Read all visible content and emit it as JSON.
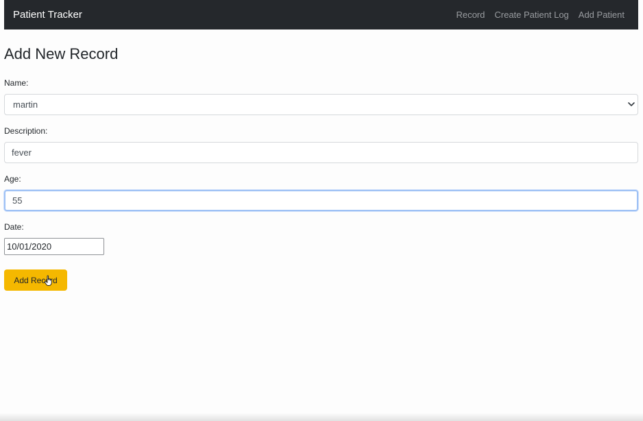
{
  "navbar": {
    "brand": "Patient Tracker",
    "links": [
      {
        "label": "Record"
      },
      {
        "label": "Create Patient Log"
      },
      {
        "label": "Add Patient"
      }
    ]
  },
  "page": {
    "title": "Add New Record"
  },
  "form": {
    "name": {
      "label": "Name:",
      "selected": "martin"
    },
    "description": {
      "label": "Description:",
      "value": "fever"
    },
    "age": {
      "label": "Age:",
      "value": "55"
    },
    "date": {
      "label": "Date:",
      "value": "10/01/2020"
    },
    "submit_label": "Add Record"
  },
  "icons": {
    "select_arrow": "chevron-down-icon",
    "cursor": "hand-pointer-icon"
  },
  "colors": {
    "navbar_bg": "#25282c",
    "button_bg": "#f5b800",
    "focus_border": "#9ec1f5"
  }
}
